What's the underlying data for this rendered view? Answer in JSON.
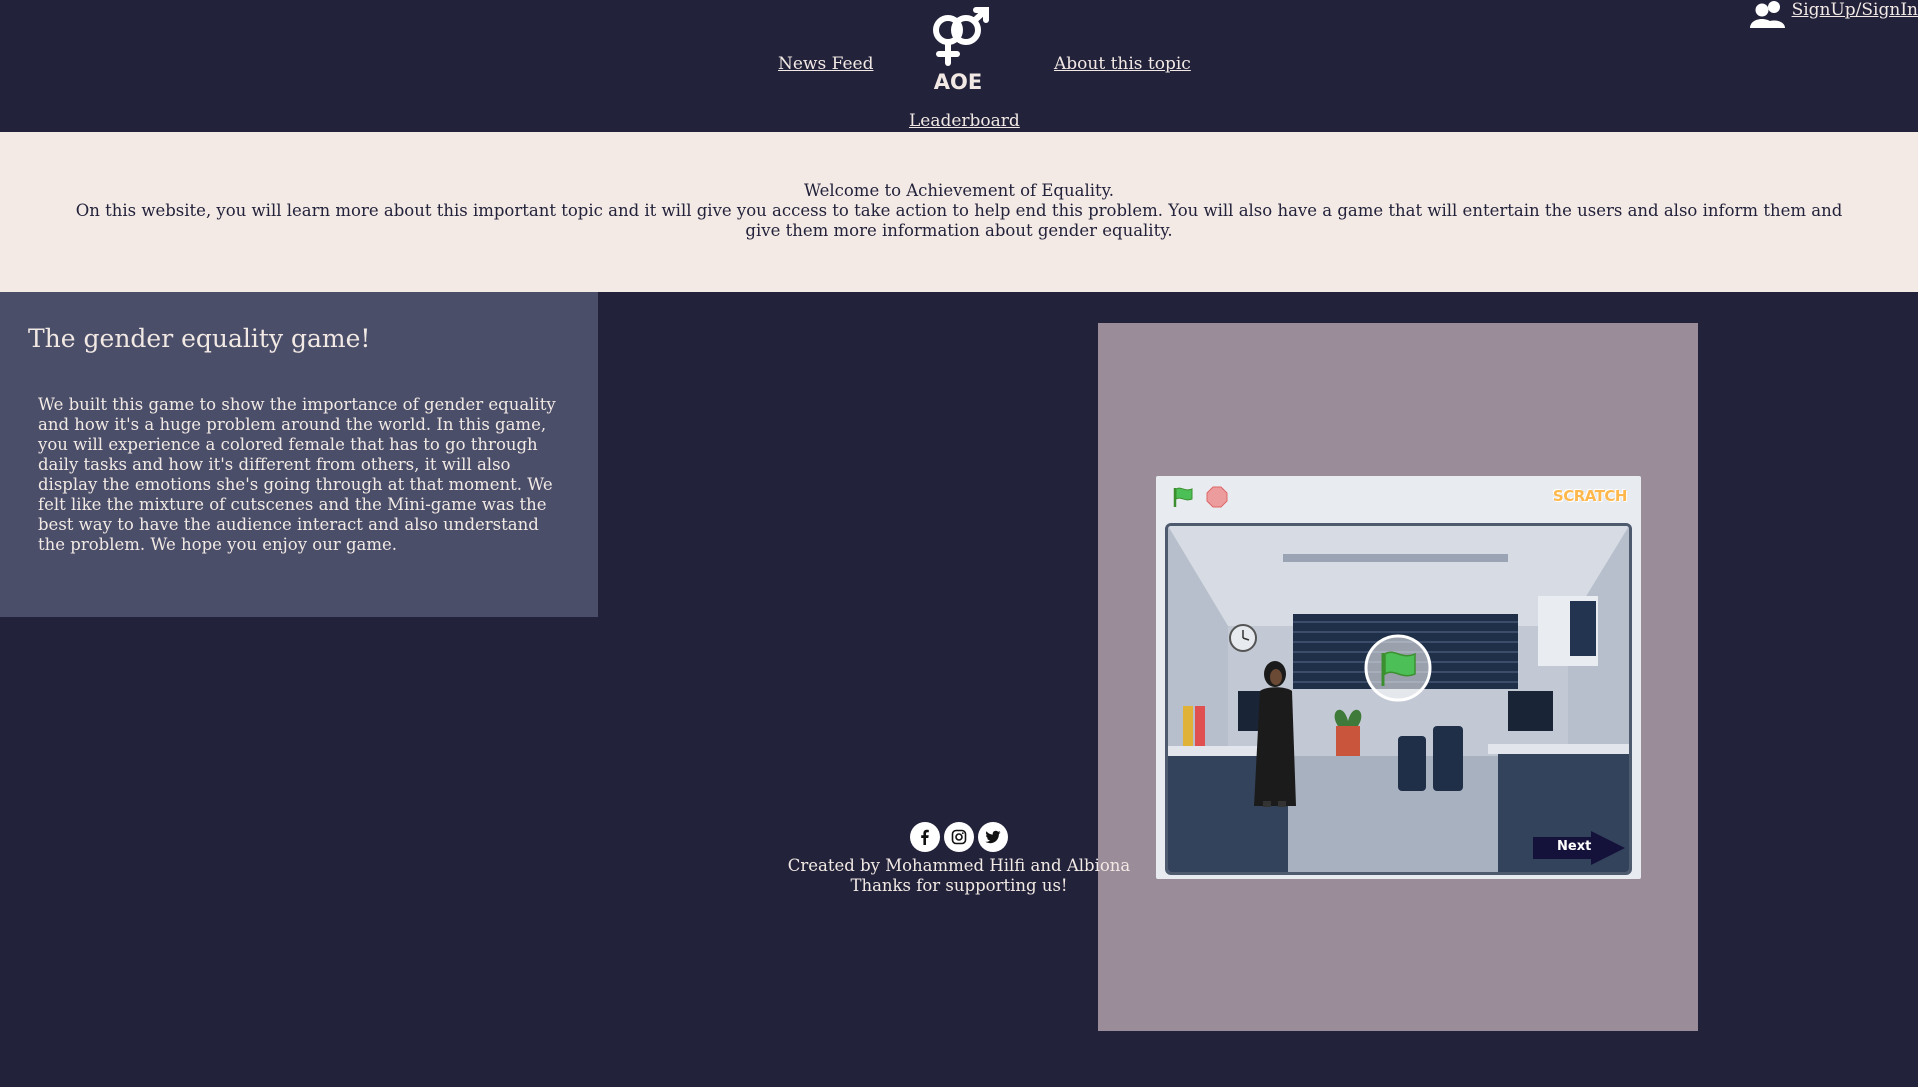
{
  "nav": {
    "news_feed": "News Feed",
    "about": "About this topic",
    "leaderboard": "Leaderboard",
    "logo_text": "AOE",
    "signin": "SignUp/SignIn"
  },
  "welcome": {
    "line1": "Welcome to Achievement of Equality.",
    "line2": "On this website, you will learn more about this important topic and it will give you access to take action to help end this problem. You will also have a game that will entertain the users and also inform them and give them more information about gender equality."
  },
  "info": {
    "title": "The gender equality game!",
    "body": "We built this game to show the importance of gender equality and how it's a huge problem around the world. In this game, you will experience a colored female that has to go through daily tasks and how it's different from others, it will also display the emotions she's going through at that moment. We felt like the mixture of cutscenes and the Mini-game was the best way to have the audience interact and also understand the problem. We hope you enjoy our game."
  },
  "game": {
    "brand": "SCRATCH",
    "next_label": "Next"
  },
  "footer": {
    "credit": "Created by Mohammed Hilfi and Albiona",
    "thanks": "Thanks for supporting us!"
  },
  "icons": {
    "user": "users-icon",
    "logo": "gender-symbol-icon",
    "facebook": "facebook-icon",
    "instagram": "instagram-icon",
    "twitter": "twitter-icon",
    "green_flag": "green-flag-icon",
    "stop": "stop-icon"
  },
  "colors": {
    "background": "#22223b",
    "band": "#f4eae5",
    "card": "#4a4e69",
    "game_panel": "#9a8c98",
    "text_light": "#f2e9e4"
  }
}
